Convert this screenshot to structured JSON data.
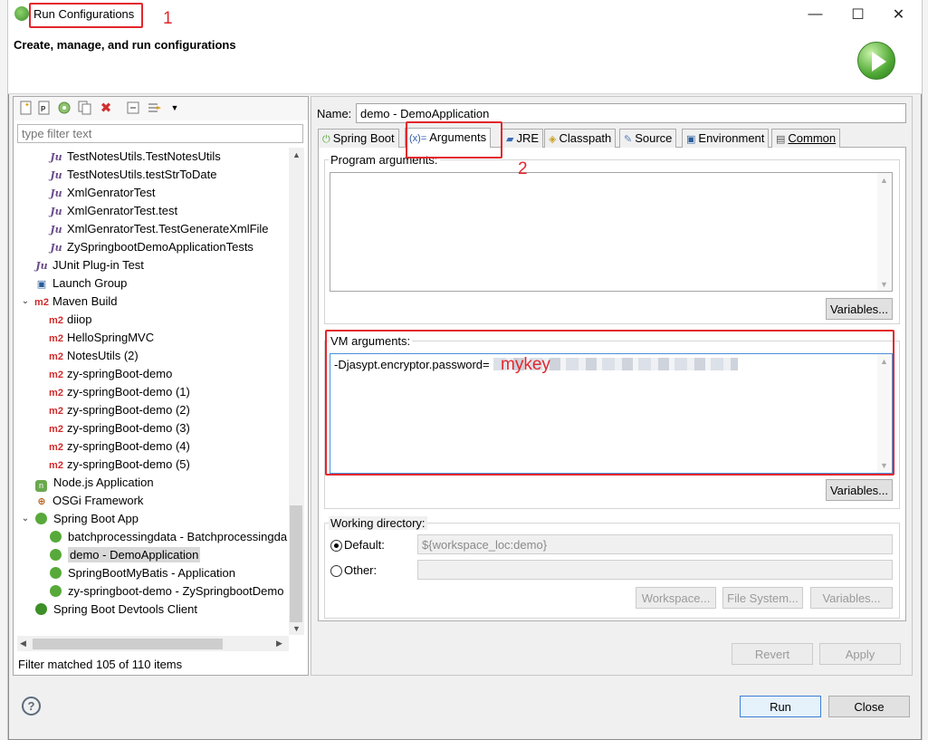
{
  "window": {
    "title": "Run Configurations",
    "header": "Create, manage, and run configurations",
    "controls": {
      "minimize": "—",
      "maximize": "☐",
      "close": "✕"
    }
  },
  "left": {
    "filter_placeholder": "type filter text",
    "tree": [
      {
        "label": "TestNotesUtils.TestNotesUtils",
        "icon": "junit-icon"
      },
      {
        "label": "TestNotesUtils.testStrToDate",
        "icon": "junit-icon"
      },
      {
        "label": "XmlGenratorTest",
        "icon": "junit-icon"
      },
      {
        "label": "XmlGenratorTest.test",
        "icon": "junit-icon"
      },
      {
        "label": "XmlGenratorTest.TestGenerateXmlFile",
        "icon": "junit-icon"
      },
      {
        "label": "ZySpringbootDemoApplicationTests",
        "icon": "junit-icon"
      },
      {
        "label": "JUnit Plug-in Test",
        "icon": "junit-plugin-icon"
      },
      {
        "label": "Launch Group",
        "icon": "launch-group-icon"
      },
      {
        "label": "Maven Build",
        "icon": "maven-icon",
        "expanded": true
      },
      {
        "label": "diiop",
        "icon": "maven-icon"
      },
      {
        "label": "HelloSpringMVC",
        "icon": "maven-icon"
      },
      {
        "label": "NotesUtils (2)",
        "icon": "maven-icon"
      },
      {
        "label": "zy-springBoot-demo",
        "icon": "maven-icon"
      },
      {
        "label": "zy-springBoot-demo (1)",
        "icon": "maven-icon"
      },
      {
        "label": "zy-springBoot-demo (2)",
        "icon": "maven-icon"
      },
      {
        "label": "zy-springBoot-demo (3)",
        "icon": "maven-icon"
      },
      {
        "label": "zy-springBoot-demo (4)",
        "icon": "maven-icon"
      },
      {
        "label": "zy-springBoot-demo (5)",
        "icon": "maven-icon"
      },
      {
        "label": "Node.js Application",
        "icon": "nodejs-icon"
      },
      {
        "label": "OSGi Framework",
        "icon": "osgi-icon"
      },
      {
        "label": "Spring Boot App",
        "icon": "spring-boot-icon",
        "expanded": true
      },
      {
        "label": "batchprocessingdata - Batchprocessingda",
        "icon": "spring-boot-icon"
      },
      {
        "label": "demo - DemoApplication",
        "icon": "spring-boot-icon",
        "selected": true
      },
      {
        "label": "SpringBootMyBatis - Application",
        "icon": "spring-boot-icon"
      },
      {
        "label": "zy-springboot-demo - ZySpringbootDemo",
        "icon": "spring-boot-icon"
      },
      {
        "label": "Spring Boot Devtools Client",
        "icon": "devtools-icon"
      }
    ],
    "status": "Filter matched 105 of 110 items"
  },
  "right": {
    "name_label": "Name:",
    "name_value": "demo - DemoApplication",
    "tabs": [
      {
        "label": "Spring Boot",
        "icon": "spring-boot-icon"
      },
      {
        "label": "Arguments",
        "icon": "arguments-icon",
        "active": true
      },
      {
        "label": "JRE",
        "icon": "jre-icon"
      },
      {
        "label": "Classpath",
        "icon": "classpath-icon"
      },
      {
        "label": "Source",
        "icon": "source-icon"
      },
      {
        "label": "Environment",
        "icon": "environment-icon"
      },
      {
        "label": "Common",
        "icon": "common-icon"
      }
    ],
    "program_args_label": "Program arguments:",
    "program_args_value": "",
    "variables_label": "Variables...",
    "vm_args_label": "VM arguments:",
    "vm_args_value": "-Djasypt.encryptor.password=",
    "working_dir_label": "Working directory:",
    "default_label": "Default:",
    "default_value": "${workspace_loc:demo}",
    "other_label": "Other:",
    "workspace_button": "Workspace...",
    "filesystem_button": "File System...",
    "revert_button": "Revert",
    "apply_button": "Apply"
  },
  "footer": {
    "help": "?",
    "run_button": "Run",
    "close_button": "Close"
  },
  "annotations": {
    "one": "1",
    "two": "2",
    "mykey": "mykey",
    "color": "#e3262c"
  }
}
